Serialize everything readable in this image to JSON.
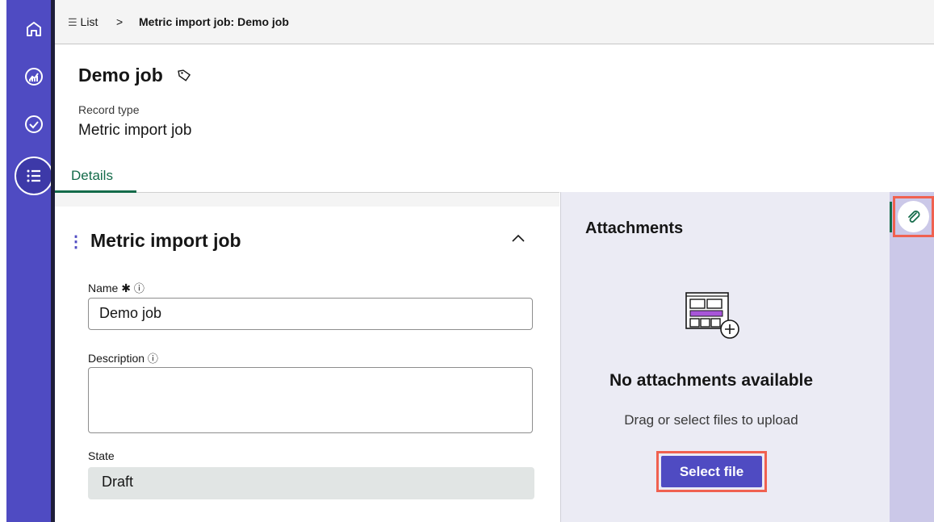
{
  "breadcrumb": {
    "list_label": "List",
    "separator": ">",
    "current": "Metric import job: Demo job"
  },
  "record": {
    "title": "Demo job",
    "type_label": "Record type",
    "type_value": "Metric import job"
  },
  "tabs": [
    {
      "label": "Details",
      "active": true
    }
  ],
  "section": {
    "title": "Metric import job",
    "fields": {
      "name": {
        "label": "Name",
        "required_mark": "✱",
        "value": "Demo job"
      },
      "description": {
        "label": "Description",
        "value": ""
      },
      "state": {
        "label": "State",
        "value": "Draft"
      }
    }
  },
  "attachments": {
    "title": "Attachments",
    "empty_title": "No attachments available",
    "hint": "Drag or select files to upload",
    "select_button": "Select file"
  },
  "rail": {
    "items": [
      "home-icon",
      "dashboard-icon",
      "check-circle-icon",
      "list-icon"
    ],
    "active": "list-icon"
  },
  "colors": {
    "rail": "#4f4bc2",
    "accent_green": "#146b4a",
    "attachments_bg": "#ebebf4",
    "highlight": "#f06150"
  }
}
